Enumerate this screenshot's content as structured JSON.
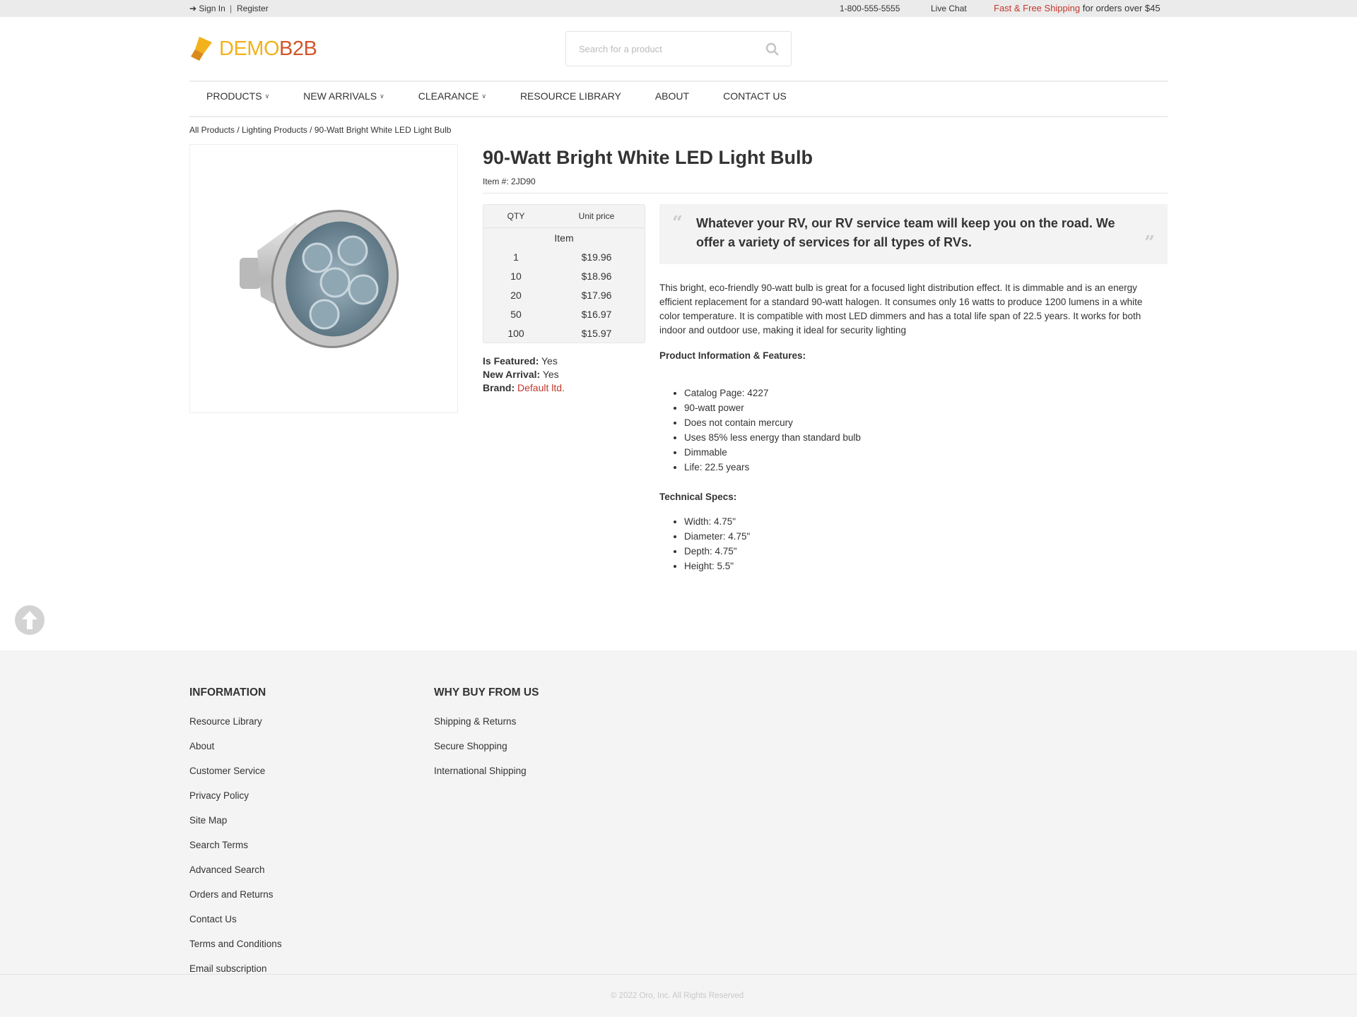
{
  "topbar": {
    "sign_in": "Sign In",
    "separator": "|",
    "register": "Register",
    "phone": "1-800-555-5555",
    "live_chat": "Live Chat",
    "shipping_link": "Fast & Free Shipping",
    "shipping_text": " for orders over $45"
  },
  "header": {
    "logo_part1": "DEMO",
    "logo_part2": "B2B",
    "search_placeholder": "Search for a product"
  },
  "nav": [
    {
      "label": "PRODUCTS",
      "dropdown": true
    },
    {
      "label": "NEW ARRIVALS",
      "dropdown": true
    },
    {
      "label": "CLEARANCE",
      "dropdown": true
    },
    {
      "label": "RESOURCE LIBRARY",
      "dropdown": false
    },
    {
      "label": "ABOUT",
      "dropdown": false
    },
    {
      "label": "CONTACT US",
      "dropdown": false
    }
  ],
  "breadcrumb": [
    "All Products",
    "Lighting Products",
    "90-Watt Bright White LED Light Bulb"
  ],
  "product": {
    "title": "90-Watt Bright White LED Light Bulb",
    "item_no": "Item #: 2JD90",
    "price_table": {
      "headers": [
        "QTY",
        "Unit price"
      ],
      "unit": "Item",
      "rows": [
        {
          "qty": "1",
          "price": "$19.96"
        },
        {
          "qty": "10",
          "price": "$18.96"
        },
        {
          "qty": "20",
          "price": "$17.96"
        },
        {
          "qty": "50",
          "price": "$16.97"
        },
        {
          "qty": "100",
          "price": "$15.97"
        }
      ]
    },
    "meta": {
      "featured_label": "Is Featured:",
      "featured": " Yes",
      "new_label": "New Arrival:",
      "new": " Yes",
      "brand_label": "Brand:",
      "brand": "Default ltd."
    },
    "quote": "Whatever your RV, our RV service team will keep you on the road. We offer a variety of services for all types of RVs.",
    "description": "This bright, eco-friendly 90-watt bulb is great for a focused light distribution effect. It is dimmable and is an energy efficient replacement for a standard 90-watt halogen. It consumes only 16 watts to produce 1200 lumens in a white color temperature. It is compatible with most LED dimmers and has a total life span of 22.5 years. It works for both indoor and outdoor use, making it ideal for security lighting",
    "features_title": "Product Information & Features:",
    "features": [
      "Catalog Page: 4227",
      "90-watt power",
      "Does not contain mercury",
      "Uses 85% less energy than standard bulb",
      "Dimmable",
      "Life: 22.5 years"
    ],
    "specs_title": "Technical Specs:",
    "specs": [
      "Width: 4.75\"",
      "Diameter: 4.75\"",
      "Depth: 4.75\"",
      "Height: 5.5\""
    ]
  },
  "footer": {
    "information_title": "INFORMATION",
    "information": [
      "Resource Library",
      "About",
      "Customer Service",
      "Privacy Policy",
      "Site Map",
      "Search Terms",
      "Advanced Search",
      "Orders and Returns",
      "Contact Us",
      "Terms and Conditions",
      "Email subscription"
    ],
    "why_title": "WHY BUY FROM US",
    "why": [
      "Shipping & Returns",
      "Secure Shopping",
      "International Shipping"
    ],
    "copyright": "© 2022 Oro, Inc. All Rights Reserved"
  },
  "colors": {
    "accent": "#c0392b",
    "logo_yellow": "#f2b21c",
    "logo_orange": "#d2552a"
  }
}
